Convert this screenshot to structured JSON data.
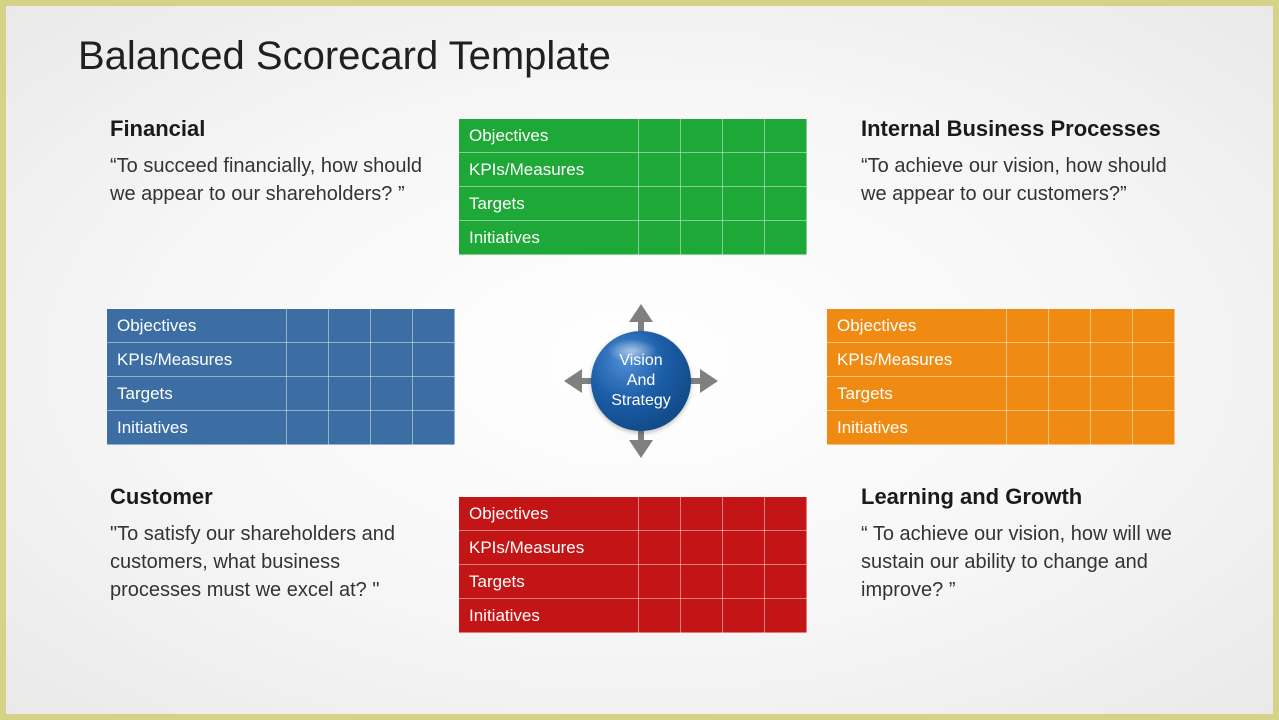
{
  "title": "Balanced Scorecard Template",
  "hub": {
    "line1": "Vision",
    "line2": "And",
    "line3": "Strategy"
  },
  "rows": {
    "objectives": "Objectives",
    "kpis": "KPIs/Measures",
    "targets": "Targets",
    "initiatives": "Initiatives"
  },
  "perspectives": {
    "financial": {
      "heading": "Financial",
      "desc": "“To succeed financially, how should we appear to our shareholders? ”"
    },
    "internal": {
      "heading": "Internal Business Processes",
      "desc": "“To achieve our vision, how should we appear to our customers?”"
    },
    "customer": {
      "heading": "Customer",
      "desc": "\"To satisfy our shareholders and customers, what business processes must we excel at? \""
    },
    "learning": {
      "heading": "Learning and Growth",
      "desc": "“ To achieve our vision, how will we sustain our ability to change and improve? ”"
    }
  }
}
